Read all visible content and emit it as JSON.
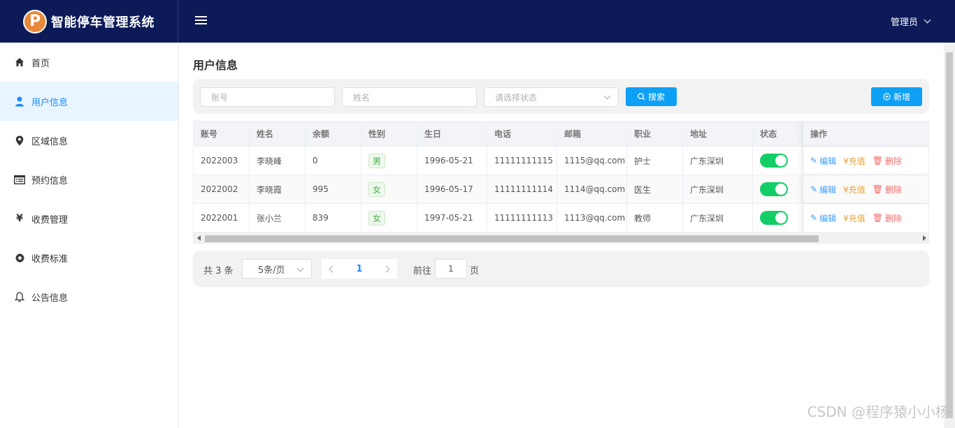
{
  "app": {
    "logo_letter": "P",
    "title": "智能停车管理系统",
    "user": "管理员"
  },
  "sidebar": {
    "items": [
      {
        "label": "首页",
        "icon": "home-icon"
      },
      {
        "label": "用户信息",
        "icon": "user-icon",
        "active": true
      },
      {
        "label": "区域信息",
        "icon": "map-pin-icon"
      },
      {
        "label": "预约信息",
        "icon": "list-icon"
      },
      {
        "label": "收费管理",
        "icon": "yen-icon"
      },
      {
        "label": "收费标准",
        "icon": "gear-icon"
      },
      {
        "label": "公告信息",
        "icon": "bell-icon"
      }
    ]
  },
  "page": {
    "title": "用户信息"
  },
  "search": {
    "account_placeholder": "账号",
    "name_placeholder": "姓名",
    "status_placeholder": "请选择状态",
    "search_label": "搜索",
    "add_label": "新增"
  },
  "table": {
    "columns": [
      "账号",
      "姓名",
      "余额",
      "性别",
      "生日",
      "电话",
      "邮箱",
      "职业",
      "地址",
      "状态",
      "操作"
    ],
    "rows": [
      {
        "account": "2022003",
        "name": "李晓峰",
        "balance": "0",
        "gender": "男",
        "birthday": "1996-05-21",
        "phone": "11111111115",
        "email": "1115@qq.com",
        "job": "护士",
        "address": "广东深圳",
        "enabled": true
      },
      {
        "account": "2022002",
        "name": "李晓霞",
        "balance": "995",
        "gender": "女",
        "birthday": "1996-05-17",
        "phone": "11111111114",
        "email": "1114@qq.com",
        "job": "医生",
        "address": "广东深圳",
        "enabled": true
      },
      {
        "account": "2022001",
        "name": "张小兰",
        "balance": "839",
        "gender": "女",
        "birthday": "1997-05-21",
        "phone": "11111111113",
        "email": "1113@qq.com",
        "job": "教师",
        "address": "广东深圳",
        "enabled": true
      }
    ],
    "ops": {
      "edit": "编辑",
      "charge": "¥充值",
      "delete": "删除"
    }
  },
  "pager": {
    "total": "共 3 条",
    "page_size": "5条/页",
    "current": "1",
    "goto": "前往",
    "goto_value": "1",
    "page_unit": "页"
  },
  "watermark": "CSDN @程序猿小小杨",
  "colors": {
    "topbar": "#0c1b58",
    "accent": "#1a8cff",
    "button": "#0da0f5",
    "switch_on": "#13ce66"
  }
}
